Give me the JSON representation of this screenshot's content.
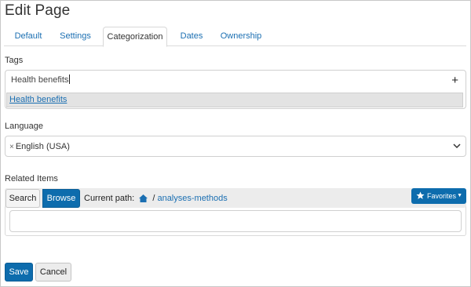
{
  "page": {
    "title": "Edit Page"
  },
  "tabs": [
    {
      "label": "Default",
      "active": false
    },
    {
      "label": "Settings",
      "active": false
    },
    {
      "label": "Categorization",
      "active": true
    },
    {
      "label": "Dates",
      "active": false
    },
    {
      "label": "Ownership",
      "active": false
    }
  ],
  "tags": {
    "label": "Tags",
    "input_value": "Health benefits",
    "suggestion": "Health benefits"
  },
  "language": {
    "label": "Language",
    "selected": "English (USA)"
  },
  "related_items": {
    "label": "Related Items",
    "search_button": "Search",
    "browse_button": "Browse",
    "current_path_label": "Current path:",
    "separator": "/",
    "path_link": "analyses-methods",
    "favorites_button": "Favorites"
  },
  "footer": {
    "save_button": "Save",
    "cancel_button": "Cancel"
  },
  "colors": {
    "primary": "#0d6cad",
    "link": "#1b6fb2"
  }
}
